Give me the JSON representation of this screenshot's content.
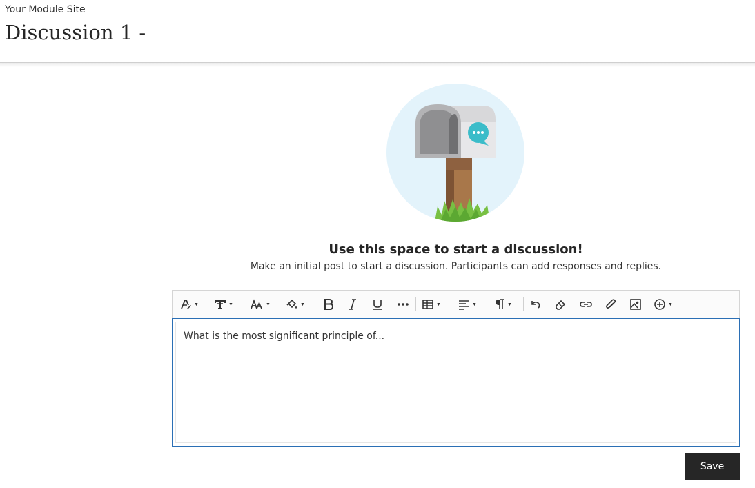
{
  "header": {
    "site_name": "Your Module Site",
    "title": "Discussion 1 -"
  },
  "empty_state": {
    "illustration": "mailbox-illustration",
    "heading": "Use this space to start a discussion!",
    "subheading": "Make an initial post to start a discussion. Participants can add responses and replies."
  },
  "toolbar": {
    "buttons": [
      {
        "icon": "text-style-icon",
        "dropdown": true
      },
      {
        "icon": "font-family-icon",
        "dropdown": true
      },
      {
        "icon": "font-size-icon",
        "dropdown": true
      },
      {
        "icon": "fill-color-icon",
        "dropdown": true
      },
      {
        "icon": "bold-icon",
        "dropdown": false
      },
      {
        "icon": "italic-icon",
        "dropdown": false
      },
      {
        "icon": "underline-icon",
        "dropdown": false
      },
      {
        "icon": "more-icon",
        "dropdown": false
      },
      {
        "icon": "table-icon",
        "dropdown": true
      },
      {
        "icon": "align-icon",
        "dropdown": true
      },
      {
        "icon": "paragraph-icon",
        "dropdown": true
      },
      {
        "icon": "undo-icon",
        "dropdown": false
      },
      {
        "icon": "eraser-icon",
        "dropdown": false
      },
      {
        "icon": "link-icon",
        "dropdown": false
      },
      {
        "icon": "attachment-icon",
        "dropdown": false
      },
      {
        "icon": "image-icon",
        "dropdown": false
      },
      {
        "icon": "insert-icon",
        "dropdown": true
      }
    ]
  },
  "editor": {
    "content": "What is the most significant principle of..."
  },
  "actions": {
    "save_label": "Save"
  },
  "colors": {
    "accent_border": "#2b6fb5",
    "save_bg": "#262626",
    "illustration_bg": "#e3f3fb",
    "chat_bubble": "#3bbcc9"
  }
}
